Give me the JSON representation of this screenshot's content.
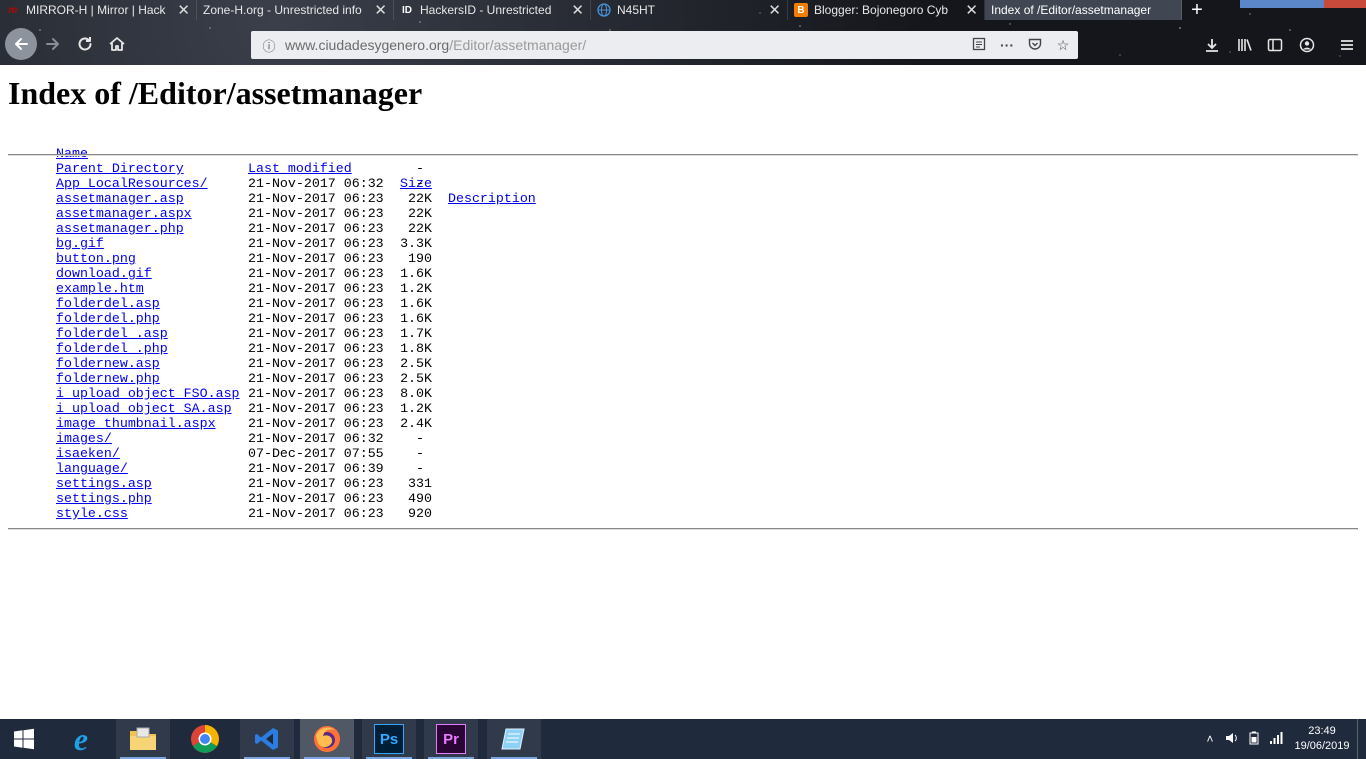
{
  "browser": {
    "tabs": [
      {
        "label": "MIRROR-H | Mirror | Hack",
        "favicon": "mirror-h-logo",
        "color": "#c00000",
        "active": false
      },
      {
        "label": "Zone-H.org - Unrestricted info",
        "favicon": "",
        "color": "",
        "active": false
      },
      {
        "label": "HackersID - Unrestricted",
        "favicon": "hackersid-logo",
        "color": "#ffffff",
        "active": false
      },
      {
        "label": "N45HT",
        "favicon": "globe-icon",
        "color": "#4a90d9",
        "active": false
      },
      {
        "label": "Blogger: Bojonegoro Cyb",
        "favicon": "blogger-logo",
        "color": "#f57d00",
        "active": false
      },
      {
        "label": "Index of /Editor/assetmanager",
        "favicon": "",
        "color": "",
        "active": true
      }
    ],
    "new_tab_label": "+",
    "url_host": "www.ciudadesygenero.org",
    "url_path": "/Editor/assetmanager/"
  },
  "page": {
    "title": "Index of /Editor/assetmanager",
    "headers": {
      "name": "Name",
      "modified": "Last modified",
      "size": "Size",
      "description": "Description"
    },
    "entries": [
      {
        "name": "Parent Directory",
        "modified": "",
        "size": "-"
      },
      {
        "name": "App_LocalResources/",
        "modified": "21-Nov-2017 06:32",
        "size": "-"
      },
      {
        "name": "assetmanager.asp",
        "modified": "21-Nov-2017 06:23",
        "size": "22K"
      },
      {
        "name": "assetmanager.aspx",
        "modified": "21-Nov-2017 06:23",
        "size": "22K"
      },
      {
        "name": "assetmanager.php",
        "modified": "21-Nov-2017 06:23",
        "size": "22K"
      },
      {
        "name": "bg.gif",
        "modified": "21-Nov-2017 06:23",
        "size": "3.3K"
      },
      {
        "name": "button.png",
        "modified": "21-Nov-2017 06:23",
        "size": "190"
      },
      {
        "name": "download.gif",
        "modified": "21-Nov-2017 06:23",
        "size": "1.6K"
      },
      {
        "name": "example.htm",
        "modified": "21-Nov-2017 06:23",
        "size": "1.2K"
      },
      {
        "name": "folderdel.asp",
        "modified": "21-Nov-2017 06:23",
        "size": "1.6K"
      },
      {
        "name": "folderdel.php",
        "modified": "21-Nov-2017 06:23",
        "size": "1.6K"
      },
      {
        "name": "folderdel_.asp",
        "modified": "21-Nov-2017 06:23",
        "size": "1.7K"
      },
      {
        "name": "folderdel_.php",
        "modified": "21-Nov-2017 06:23",
        "size": "1.8K"
      },
      {
        "name": "foldernew.asp",
        "modified": "21-Nov-2017 06:23",
        "size": "2.5K"
      },
      {
        "name": "foldernew.php",
        "modified": "21-Nov-2017 06:23",
        "size": "2.5K"
      },
      {
        "name": "i_upload_object_FSO.asp",
        "modified": "21-Nov-2017 06:23",
        "size": "8.0K"
      },
      {
        "name": "i_upload_object_SA.asp",
        "modified": "21-Nov-2017 06:23",
        "size": "1.2K"
      },
      {
        "name": "image_thumbnail.aspx",
        "modified": "21-Nov-2017 06:23",
        "size": "2.4K"
      },
      {
        "name": "images/",
        "modified": "21-Nov-2017 06:32",
        "size": "-"
      },
      {
        "name": "isaeken/",
        "modified": "07-Dec-2017 07:55",
        "size": "-"
      },
      {
        "name": "language/",
        "modified": "21-Nov-2017 06:39",
        "size": "-"
      },
      {
        "name": "settings.asp",
        "modified": "21-Nov-2017 06:23",
        "size": "331"
      },
      {
        "name": "settings.php",
        "modified": "21-Nov-2017 06:23",
        "size": "490"
      },
      {
        "name": "style.css",
        "modified": "21-Nov-2017 06:23",
        "size": "920"
      }
    ]
  },
  "taskbar": {
    "apps": [
      {
        "name": "internet-explorer-icon",
        "label": "e",
        "color": "#1ea1e6",
        "state": "pinned-idle"
      },
      {
        "name": "file-explorer-icon",
        "label": "",
        "color": "#f2c14e",
        "state": "open"
      },
      {
        "name": "chrome-icon",
        "label": "",
        "color": "#db4437",
        "state": "pinned-idle"
      },
      {
        "name": "vscode-icon",
        "label": "",
        "color": "#2d7de0",
        "state": "open"
      },
      {
        "name": "firefox-icon",
        "label": "",
        "color": "#ff7139",
        "state": "active"
      },
      {
        "name": "photoshop-icon",
        "label": "Ps",
        "color": "#31a8ff",
        "state": "open"
      },
      {
        "name": "premiere-icon",
        "label": "Pr",
        "color": "#e77bff",
        "state": "open"
      },
      {
        "name": "notepad-icon",
        "label": "",
        "color": "#8fd0f5",
        "state": "open"
      }
    ],
    "time": "23:49",
    "date": "19/06/2019"
  }
}
